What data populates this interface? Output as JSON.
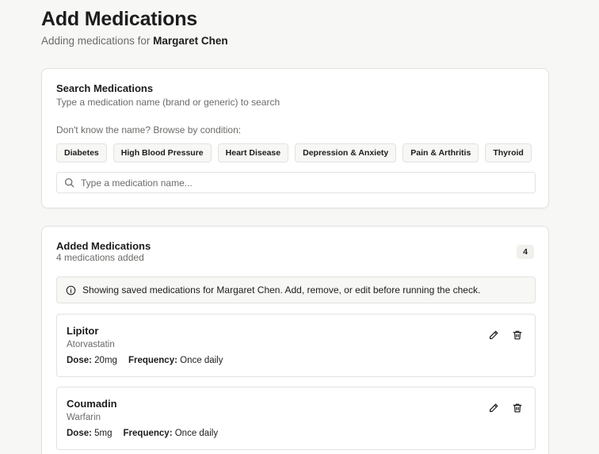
{
  "header": {
    "title": "Add Medications",
    "subtitle_prefix": "Adding medications for",
    "patient_name": "Margaret Chen"
  },
  "search": {
    "heading": "Search Medications",
    "description": "Type a medication name (brand or generic) to search",
    "browse_label": "Don't know the name? Browse by condition:",
    "conditions": [
      "Diabetes",
      "High Blood Pressure",
      "Heart Disease",
      "Depression & Anxiety",
      "Pain & Arthritis",
      "Thyroid"
    ],
    "placeholder": "Type a medication name..."
  },
  "added": {
    "heading": "Added Medications",
    "count_text": "4 medications added",
    "count": "4",
    "info": "Showing saved medications for Margaret Chen. Add, remove, or edit before running the check.",
    "dose_label": "Dose:",
    "frequency_label": "Frequency:",
    "medications": [
      {
        "name": "Lipitor",
        "generic": "Atorvastatin",
        "dose": "20mg",
        "frequency": "Once daily"
      },
      {
        "name": "Coumadin",
        "generic": "Warfarin",
        "dose": "5mg",
        "frequency": "Once daily"
      }
    ]
  },
  "icons": {
    "search": "search-icon",
    "info": "info-icon",
    "edit": "pencil-icon",
    "delete": "trash-icon"
  },
  "colors": {
    "background": "#f7f7f6",
    "card": "#ffffff",
    "border": "#e3e2de",
    "text": "#1c1c1c",
    "muted": "#6b6b68"
  }
}
